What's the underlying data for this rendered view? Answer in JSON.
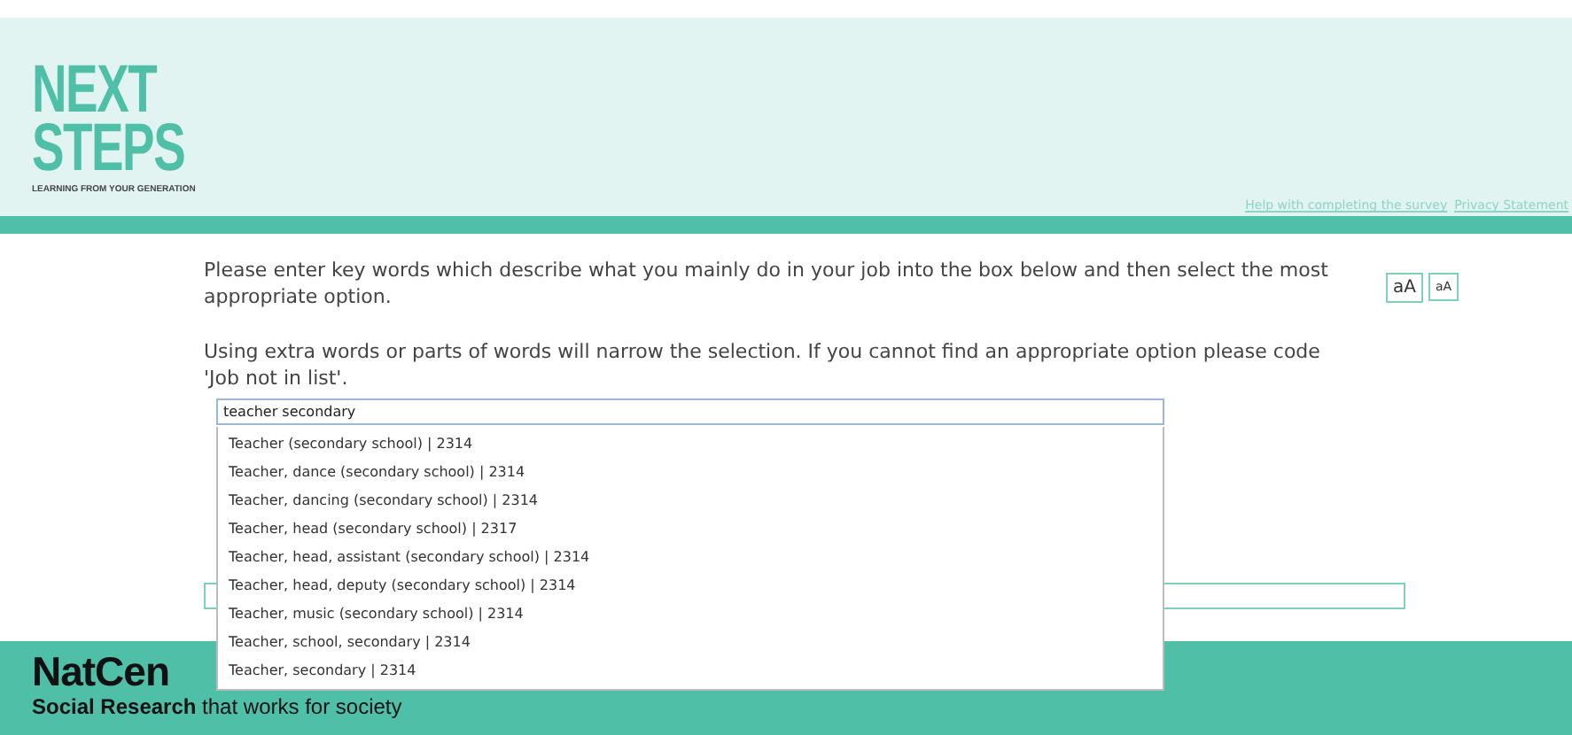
{
  "header": {
    "logo": {
      "line_1": "NEXT",
      "line_2": "STEPS",
      "tagline": "LEARNING FROM YOUR GENERATION"
    },
    "links": [
      "Help with completing the survey",
      "Privacy Statement"
    ]
  },
  "instructions": [
    "Please enter key words which describe what you mainly do in your job into the box below and then select the most appropriate option.",
    "Using extra words or parts of words will narrow the selection. If you cannot find an appropriate option please code 'Job not in list'."
  ],
  "font_size_buttons": [
    "aA",
    "aA"
  ],
  "search": {
    "value": "teacher secondary"
  },
  "suggestions": [
    "Teacher (secondary school) | 2314",
    "Teacher, dance (secondary school) | 2314",
    "Teacher, dancing (secondary school) | 2314",
    "Teacher, head (secondary school) | 2317",
    "Teacher, head, assistant (secondary school) | 2314",
    "Teacher, head, deputy (secondary school) | 2314",
    "Teacher, music (secondary school) | 2314",
    "Teacher, school, secondary | 2314",
    "Teacher, secondary | 2314"
  ],
  "footer": {
    "brand": "NatCen",
    "tagline": "**Social Research** that works for society"
  }
}
